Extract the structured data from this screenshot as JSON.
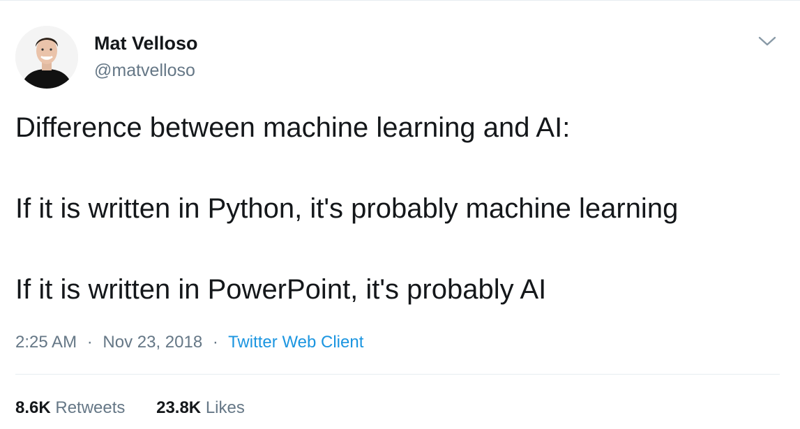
{
  "tweet": {
    "author": {
      "name": "Mat Velloso",
      "handle": "@matvelloso"
    },
    "text_lines": [
      "Difference between machine learning and AI:",
      "If it is written in Python, it's probably machine learning",
      "If it is written in PowerPoint, it's probably AI"
    ],
    "meta": {
      "time": "2:25 AM",
      "separator": "·",
      "date": "Nov 23, 2018",
      "client": "Twitter Web Client"
    },
    "stats": {
      "retweets_count": "8.6K",
      "retweets_label": "Retweets",
      "likes_count": "23.8K",
      "likes_label": "Likes"
    }
  },
  "colors": {
    "text": "#14171a",
    "secondary": "#657786",
    "link": "#1b95e0",
    "divider": "#e6ecf0"
  },
  "icons": {
    "menu": "chevron-down-icon"
  }
}
